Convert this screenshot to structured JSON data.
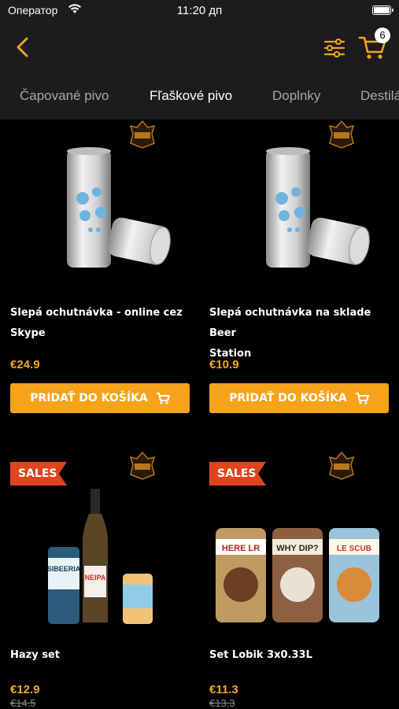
{
  "status": {
    "carrier": "Оператор",
    "time": "11:20 дп"
  },
  "nav": {
    "cart_count": "6"
  },
  "tabs": [
    "Čapované pivo",
    "Fľaškové pivo",
    "Doplnky",
    "Destilá"
  ],
  "active_tab": 1,
  "colors": {
    "accent": "#f5a31a",
    "sales_badge": "#e0441d",
    "header": "#1c1c1e",
    "price": "#f5a623"
  },
  "products": [
    {
      "name_line1": "Slepá ochutnávka - online cez",
      "name_line2": "Skype",
      "price": "€24.9",
      "button": "PRIDAŤ DO KOŠÍKA"
    },
    {
      "name_line1": "Slepá ochutnávka na sklade Beer",
      "name_line2": "Station",
      "price": "€10.9",
      "button": "PRIDAŤ DO KOŠÍKA"
    },
    {
      "badge": "SALES",
      "name_line1": "Hazy set",
      "price": "€12.9",
      "old_price": "€14.5",
      "label_can1": "SIBEERIA",
      "label_bottle": "NEIPA"
    },
    {
      "badge": "SALES",
      "name_line1": "Set Lobik 3x0.33L",
      "price": "€11.3",
      "old_price": "€13.3",
      "label_can1": "HERE LR",
      "label_can2": "WHY DIP?",
      "label_can3": "LE SCUB"
    }
  ]
}
